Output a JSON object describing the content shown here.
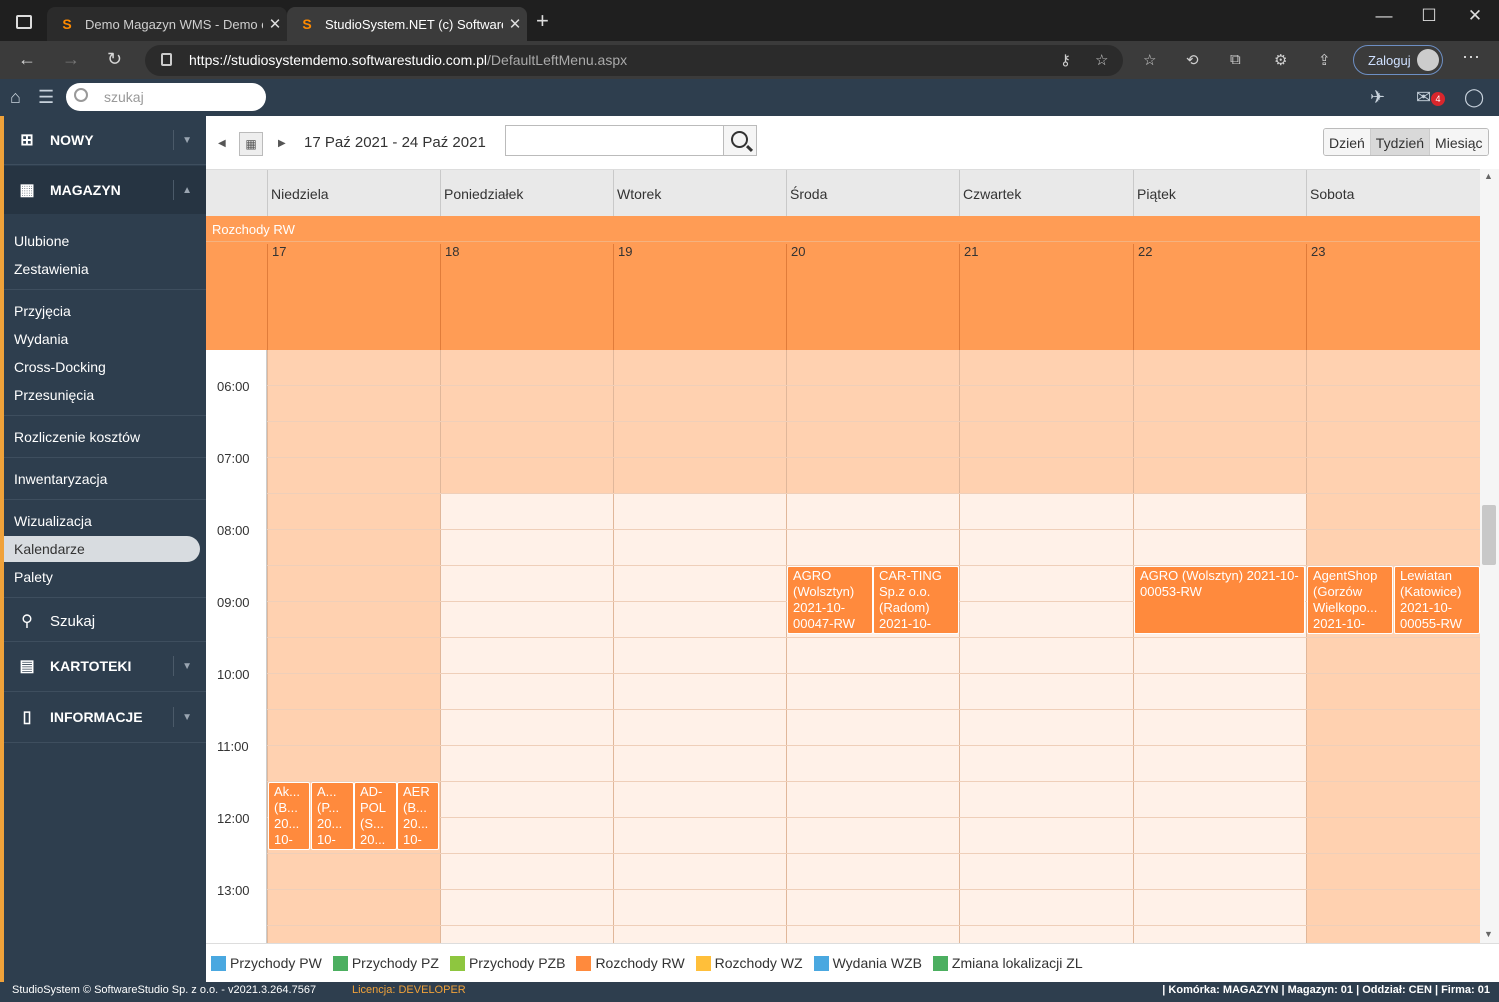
{
  "browser": {
    "tabs": [
      {
        "title": "Demo Magazyn WMS - Demo or"
      },
      {
        "title": "StudioSystem.NET (c) SoftwareSt"
      }
    ],
    "url_host": "https://studiosystemdemo.softwarestudio.com.pl",
    "url_path": "/DefaultLeftMenu.aspx",
    "login_label": "Zaloguj"
  },
  "app": {
    "search_placeholder": "szukaj",
    "mail_count": "4"
  },
  "sidebar": {
    "sections": {
      "nowy": "NOWY",
      "magazyn": "MAGAZYN",
      "szukaj": "Szukaj",
      "kartoteki": "KARTOTEKI",
      "informacje": "INFORMACJE"
    },
    "items": [
      "Ulubione",
      "Zestawienia",
      "Przyjęcia",
      "Wydania",
      "Cross-Docking",
      "Przesunięcia",
      "Rozliczenie kosztów",
      "Inwentaryzacja",
      "Wizualizacja",
      "Kalendarze",
      "Palety"
    ],
    "active": "Kalendarze"
  },
  "calendar": {
    "range": "17 Paź 2021 - 24 Paź 2021",
    "views": [
      "Dzień",
      "Tydzień",
      "Miesiąc"
    ],
    "active_view": "Tydzień",
    "days": [
      "Niedziela",
      "Poniedziałek",
      "Wtorek",
      "Środa",
      "Czwartek",
      "Piątek",
      "Sobota"
    ],
    "day_numbers": [
      "17",
      "18",
      "19",
      "20",
      "21",
      "22",
      "23"
    ],
    "allday_group": "Rozchody RW",
    "times": [
      "06:00",
      "07:00",
      "08:00",
      "09:00",
      "10:00",
      "11:00",
      "12:00",
      "13:00"
    ],
    "events": [
      {
        "text": "AGRO (Wolsztyn) 2021-10-00047-RW"
      },
      {
        "text": "CAR-TING Sp.z o.o. (Radom) 2021-10-"
      },
      {
        "text": "AGRO (Wolsztyn) 2021-10-00053-RW"
      },
      {
        "text": "AgentShop (Gorzów Wielkopo... 2021-10-"
      },
      {
        "text": "Lewiatan (Katowice) 2021-10-00055-RW"
      },
      {
        "text": "Ak... (B... 20... 10-"
      },
      {
        "text": "A... (P... 20... 10-"
      },
      {
        "text": "AD-POL (S... 20..."
      },
      {
        "text": "AER (B... 20... 10-"
      }
    ],
    "event_color": "#ff8a3d"
  },
  "legend": [
    {
      "label": "Przychody PW",
      "color": "#4aa8e0"
    },
    {
      "label": "Przychody PZ",
      "color": "#4caf60"
    },
    {
      "label": "Przychody PZB",
      "color": "#8ec63f"
    },
    {
      "label": "Rozchody RW",
      "color": "#ff8a3d"
    },
    {
      "label": "Rozchody WZ",
      "color": "#ffbf3a"
    },
    {
      "label": "Wydania WZB",
      "color": "#4aa8e0"
    },
    {
      "label": "Zmiana lokalizacji ZL",
      "color": "#4caf60"
    }
  ],
  "footer": {
    "left": "StudioSystem © SoftwareStudio Sp. z o.o. - v2021.3.264.7567",
    "license_label": "Licencja:",
    "license_value": "DEVELOPER",
    "right": "| Komórka: MAGAZYN | Magazyn: 01 | Oddział: CEN | Firma: 01"
  }
}
